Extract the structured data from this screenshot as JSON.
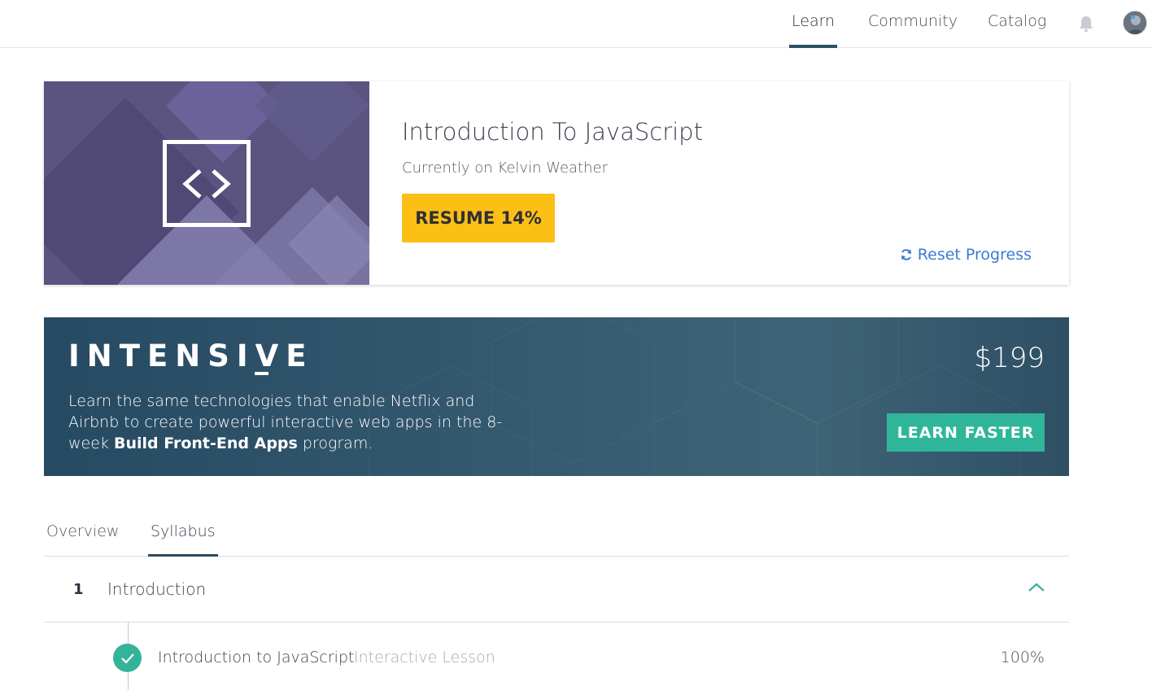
{
  "nav": {
    "items": [
      {
        "label": "Learn",
        "active": true
      },
      {
        "label": "Community",
        "active": false
      },
      {
        "label": "Catalog",
        "active": false
      }
    ],
    "bell_icon": "bell-icon",
    "avatar_icon": "user-avatar"
  },
  "course": {
    "title": "Introduction To JavaScript",
    "subtitle": "Currently on Kelvin Weather",
    "resume_label": "RESUME 14%",
    "progress_percent": 14,
    "reset_label": "Reset Progress",
    "art_icon": "code-brackets-icon",
    "art_color": "#5b5480"
  },
  "banner": {
    "brand": "INTENSIVE",
    "text_part1": "Learn the same technologies that enable Netflix and Airbnb to create powerful interactive web apps in the 8-week ",
    "text_bold": "Build Front-End Apps",
    "text_part2": " program.",
    "price": "$199",
    "cta_label": "LEARN FASTER",
    "cta_color": "#2fb69a"
  },
  "tabs": [
    {
      "label": "Overview",
      "active": false
    },
    {
      "label": "Syllabus",
      "active": true
    }
  ],
  "syllabus": {
    "section": {
      "number": "1",
      "title": "Introduction"
    },
    "lessons": [
      {
        "title": "Introduction to JavaScript",
        "type": "Interactive Lesson",
        "percent": "100%",
        "completed": true
      }
    ]
  },
  "colors": {
    "accent_teal": "#33b39a",
    "resume_yellow": "#fbbf16",
    "link_blue": "#3b7bd4",
    "nav_underline": "#2c5066"
  }
}
